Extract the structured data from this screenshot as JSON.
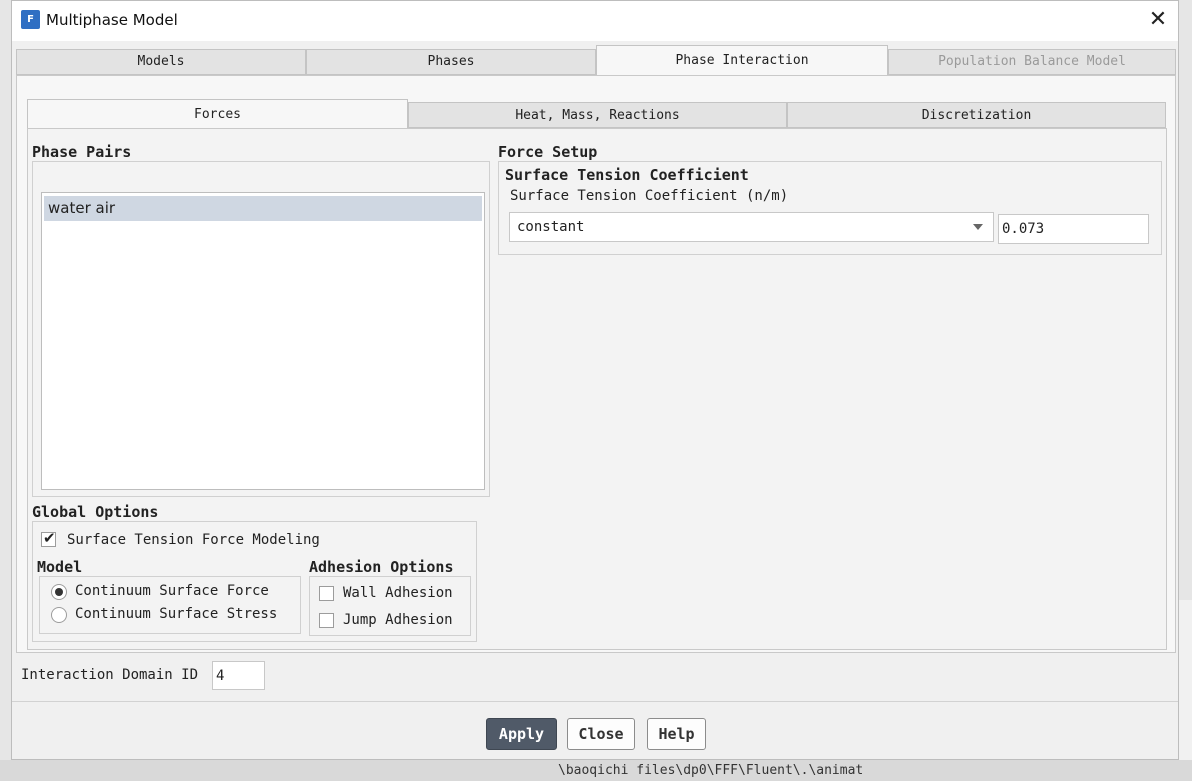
{
  "window": {
    "title": "Multiphase Model",
    "app_icon_letter": "F"
  },
  "main_tabs": [
    {
      "label": "Models",
      "state": "normal"
    },
    {
      "label": "Phases",
      "state": "normal"
    },
    {
      "label": "Phase Interaction",
      "state": "active"
    },
    {
      "label": "Population Balance Model",
      "state": "disabled"
    }
  ],
  "sub_tabs": [
    {
      "label": "Forces",
      "state": "active"
    },
    {
      "label": "Heat, Mass, Reactions",
      "state": "normal"
    },
    {
      "label": "Discretization",
      "state": "normal"
    }
  ],
  "phase_pairs": {
    "title": "Phase Pairs",
    "items": [
      "water air"
    ],
    "selected": "water air"
  },
  "force_setup": {
    "title": "Force Setup",
    "group_title": "Surface Tension Coefficient",
    "field_label": "Surface Tension Coefficient (n/m)",
    "method": "constant",
    "value": "0.073"
  },
  "global_options": {
    "title": "Global Options",
    "surface_tension_modeling": {
      "label": "Surface Tension Force Modeling",
      "checked": true
    },
    "model": {
      "title": "Model",
      "options": [
        {
          "label": "Continuum Surface Force",
          "selected": true
        },
        {
          "label": "Continuum Surface Stress",
          "selected": false
        }
      ]
    },
    "adhesion": {
      "title": "Adhesion Options",
      "options": [
        {
          "label": "Wall Adhesion",
          "checked": false
        },
        {
          "label": "Jump Adhesion",
          "checked": false
        }
      ]
    }
  },
  "interaction_domain": {
    "label": "Interaction Domain ID",
    "value": "4"
  },
  "buttons": {
    "apply": "Apply",
    "close": "Close",
    "help": "Help"
  },
  "background": {
    "command_text": "\\baoqichi files\\dp0\\FFF\\Fluent\\.\\animat"
  }
}
